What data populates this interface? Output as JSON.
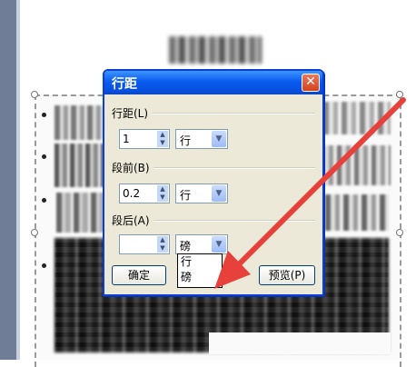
{
  "dialog": {
    "title": "行距",
    "close_symbol": "✕",
    "groups": [
      {
        "label": "行距(L)",
        "value": "1",
        "unit": "行"
      },
      {
        "label": "段前(B)",
        "value": "0.2",
        "unit": "行"
      },
      {
        "label": "段后(A)",
        "value": "",
        "unit": "磅"
      }
    ],
    "ok_label": "确定",
    "preview_label": "预览(P)",
    "unit_options": [
      "行",
      "磅"
    ]
  },
  "colors": {
    "annotation_arrow": "#e8403a",
    "titlebar": "#0b5cf0"
  },
  "icons": {
    "close": "close-icon",
    "spin": "spin-arrows-icon",
    "dropdown": "chevron-down-icon"
  }
}
